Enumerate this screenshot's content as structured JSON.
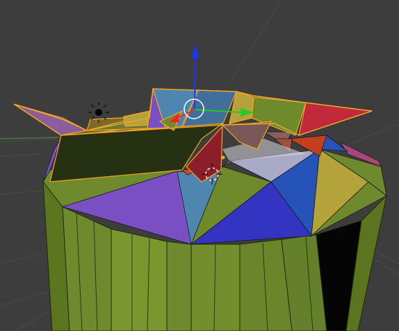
{
  "viewport": {
    "background": "#3d3d3d",
    "grid_color": "#4a4a4a",
    "axis_x_color": "#7a3b3b",
    "axis_y_color": "#5b7a3b"
  },
  "scene": {
    "object": "cylinder-mesh",
    "selection_outline_color": "#f5a623",
    "face_colors": {
      "olive": "#6f8a2c",
      "olive_dark": "#55701f",
      "purple": "#7b4fc4",
      "blue": "#3434c2",
      "royal": "#2553b8",
      "steel": "#4f86b0",
      "mustard": "#b4a23a",
      "dark_olive": "#263013",
      "red": "#c22a3c",
      "maroon": "#8a1f2a",
      "mauve": "#8b5d9a",
      "pink": "#a8467a",
      "black": "#050505"
    }
  },
  "gizmo": {
    "z_color": "#1a35ff",
    "y_color": "#22cc22",
    "x_color": "#ff2020"
  },
  "icons": {
    "lamp": "sun-lamp-icon",
    "cursor": "3d-cursor-icon",
    "pivot": "pivot-point-icon"
  }
}
